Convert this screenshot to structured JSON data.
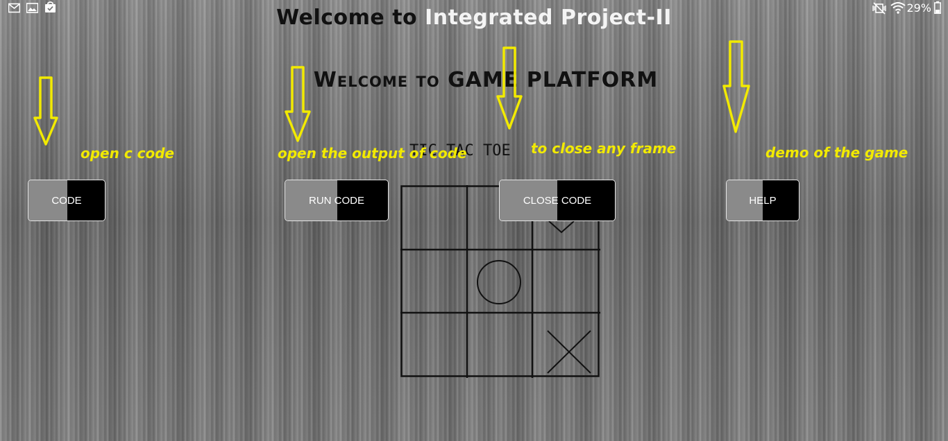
{
  "status_bar": {
    "battery_percent": "29%",
    "icons_left": [
      "gmail-icon",
      "gallery-icon",
      "store-bag-icon"
    ],
    "icons_right": [
      "mute-icon",
      "wifi-icon",
      "battery-icon"
    ]
  },
  "header": {
    "title_part1": "Welcome to",
    "title_part2": "Integrated Project-II",
    "subtitle": "Welcome to GAME PLATFORM"
  },
  "game": {
    "title": "TIC TAC TOE",
    "board": [
      "",
      "",
      "X",
      "",
      "O",
      "",
      "",
      "",
      "X"
    ]
  },
  "buttons": {
    "code": "CODE",
    "run_code": "RUN CODE",
    "close_code": "CLOSE CODE",
    "help": "HELP"
  },
  "annotations": {
    "code": "open c code",
    "run_code": "open the output of code",
    "close_code": "to close any frame",
    "help": "demo of the game"
  },
  "colors": {
    "annotation": "#f2ea00",
    "arrow": "#f2ea00",
    "button_left": "#8a8a8a",
    "button_right": "#000000"
  }
}
